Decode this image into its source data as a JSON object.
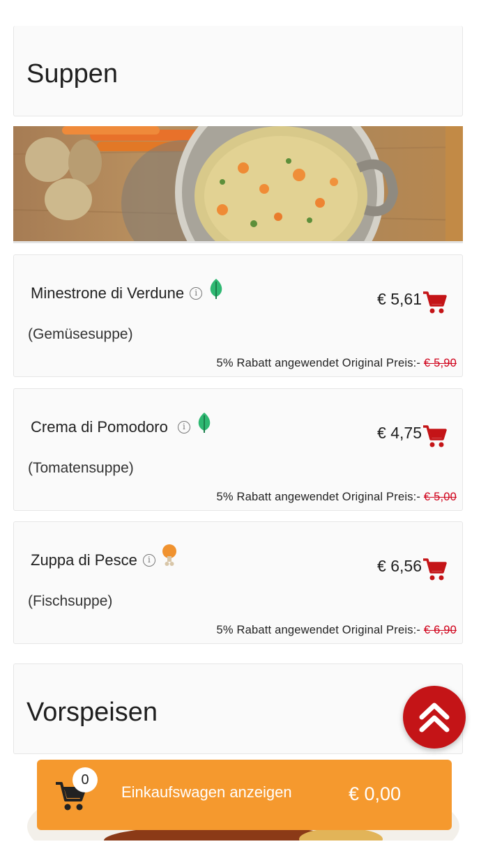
{
  "sections": {
    "soups_title": "Suppen",
    "starters_title": "Vorspeisen"
  },
  "items": [
    {
      "name": "Minestrone di Verdune",
      "description": "(Gemüsesuppe)",
      "price": "€ 5,61",
      "diet_icon": "leaf-icon",
      "discount_text": "5% Rabatt angewendet Original Preis:-",
      "original_price": "€ 5,90"
    },
    {
      "name": "Crema di Pomodoro",
      "description": "(Tomatensuppe)",
      "price": "€ 4,75",
      "diet_icon": "leaf-icon",
      "discount_text": "5% Rabatt angewendet Original Preis:-",
      "original_price": "€ 5,00"
    },
    {
      "name": "Zuppa di Pesce",
      "description": "(Fischsuppe)",
      "price": "€ 6,56",
      "diet_icon": "drumstick-icon",
      "discount_text": "5% Rabatt angewendet Original Preis:-",
      "original_price": "€ 6,90"
    }
  ],
  "cart": {
    "count": "0",
    "label": "Einkaufswagen anzeigen",
    "total": "€ 0,00"
  },
  "colors": {
    "accent_red": "#c41417",
    "cart_orange": "#f5992e",
    "strike_red": "#d0021b",
    "leaf_green": "#2eb872"
  },
  "icons": {
    "info": "info-icon",
    "add_to_cart": "cart-icon",
    "scroll_top": "double-chevron-up-icon"
  }
}
